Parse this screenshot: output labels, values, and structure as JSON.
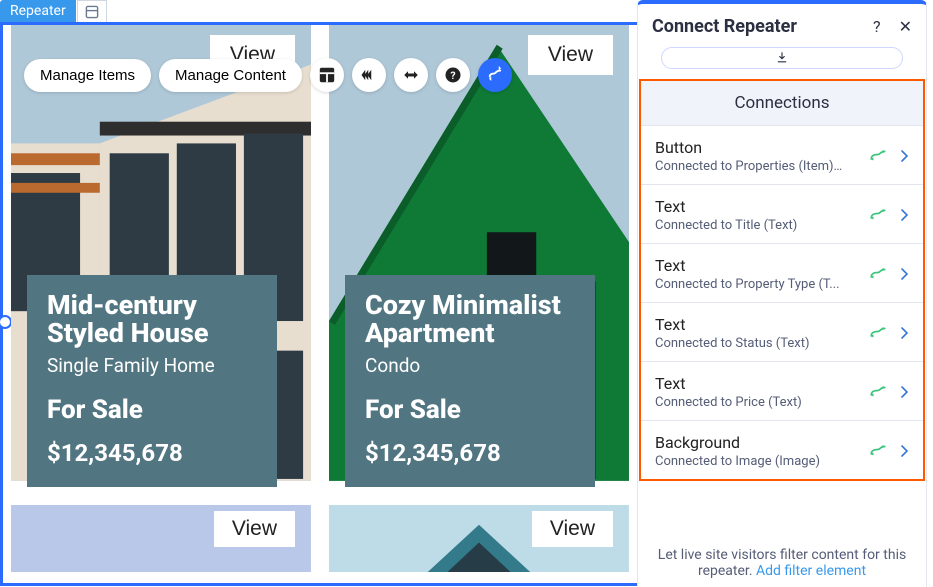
{
  "tab_label": "Repeater",
  "toolbar": {
    "manage_items": "Manage Items",
    "manage_content": "Manage Content"
  },
  "cards": [
    {
      "view": "View",
      "title": "Mid-century Styled House",
      "type": "Single Family Home",
      "status": "For Sale",
      "price": "$12,345,678"
    },
    {
      "view": "View",
      "title": "Cozy Minimalist Apartment",
      "type": "Condo",
      "status": "For Sale",
      "price": "$12,345,678"
    }
  ],
  "row2_view": "View",
  "panel": {
    "title": "Connect Repeater",
    "section_head": "Connections",
    "connections": [
      {
        "title": "Button",
        "sub": "Connected to Properties (Item) ()"
      },
      {
        "title": "Text",
        "sub": "Connected to Title (Text)"
      },
      {
        "title": "Text",
        "sub": "Connected to Property Type (T..."
      },
      {
        "title": "Text",
        "sub": "Connected to Status (Text)"
      },
      {
        "title": "Text",
        "sub": "Connected to Price (Text)"
      },
      {
        "title": "Background",
        "sub": "Connected to Image (Image)"
      }
    ],
    "footer_text": "Let live site visitors filter content for this repeater.  ",
    "footer_link": "Add filter element"
  }
}
